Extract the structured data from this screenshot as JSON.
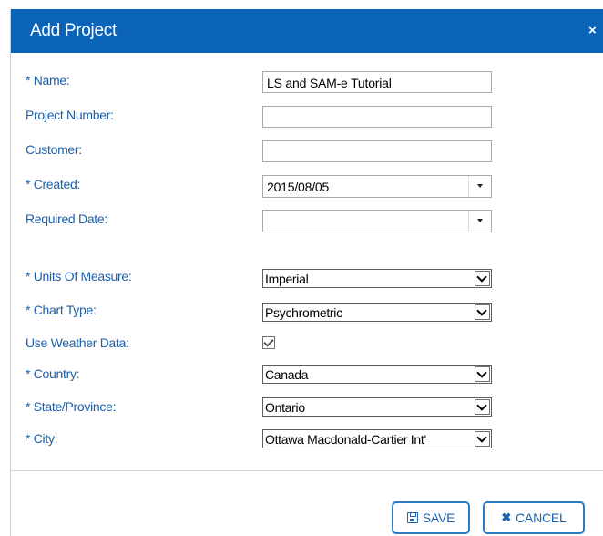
{
  "dialog": {
    "title": "Add Project",
    "close_glyph": "×"
  },
  "form": {
    "name": {
      "label": "* Name:",
      "value": "LS and SAM-e Tutorial"
    },
    "project_number": {
      "label": "Project Number:",
      "value": ""
    },
    "customer": {
      "label": "Customer:",
      "value": ""
    },
    "created": {
      "label": "* Created:",
      "value": "2015/08/05"
    },
    "required_date": {
      "label": "Required Date:",
      "value": ""
    },
    "units": {
      "label": "* Units Of Measure:",
      "value": "Imperial"
    },
    "chart_type": {
      "label": "* Chart Type:",
      "value": "Psychrometric"
    },
    "weather": {
      "label": "Use Weather Data:",
      "checked": true
    },
    "country": {
      "label": "* Country:",
      "value": "Canada"
    },
    "state": {
      "label": "* State/Province:",
      "value": "Ontario"
    },
    "city": {
      "label": "* City:",
      "value": "Ottawa Macdonald-Cartier Int'"
    }
  },
  "footer": {
    "save_label": "SAVE",
    "cancel_label": "CANCEL"
  },
  "colors": {
    "titlebar": "#0b63b8",
    "label": "#1d5fa8",
    "button_border": "#2d7bc4"
  },
  "icons": {
    "close": "close-icon",
    "save": "floppy-disk-icon",
    "cancel": "x-icon",
    "dropdown": "chevron-down-icon",
    "check": "checkmark-icon"
  }
}
